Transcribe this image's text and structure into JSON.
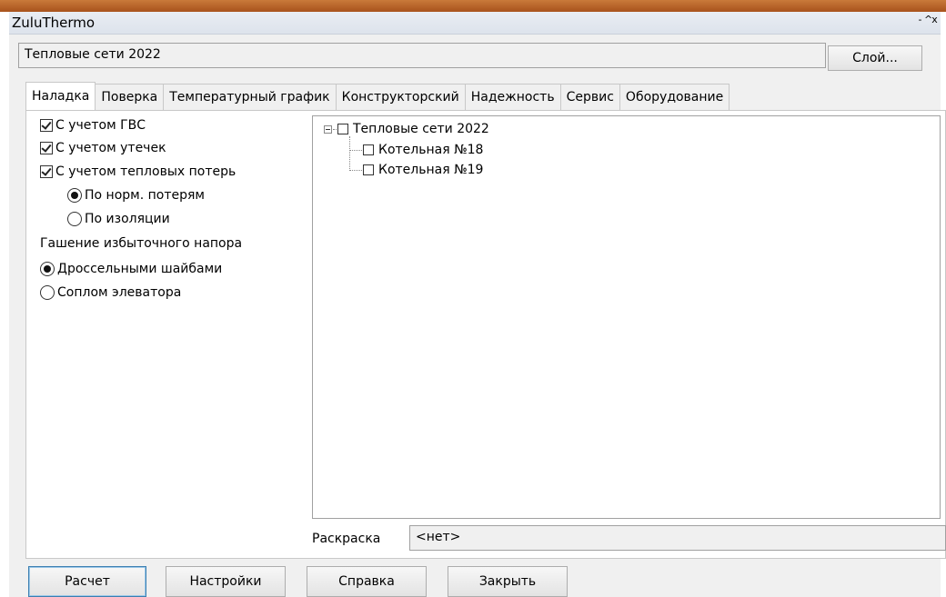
{
  "window": {
    "title": "ZuluThermo",
    "controls": [
      "-",
      "^",
      "x"
    ]
  },
  "layer": {
    "value": "Тепловые сети 2022",
    "button_label": "Слой..."
  },
  "tabs": [
    "Наладка",
    "Поверка",
    "Температурный график",
    "Конструкторский",
    "Надежность",
    "Сервис",
    "Оборудование"
  ],
  "active_tab": "Наладка",
  "options": {
    "gvs": "С учетом ГВС",
    "leaks": "С учетом утечек",
    "heat_loss": "С учетом тепловых потерь",
    "norm_loss": "По норм. потерям",
    "insulation": "По изоляции",
    "pressure_group": "Гашение избыточного напора",
    "throttle": "Дроссельными шайбами",
    "nozzle": "Соплом элеватора"
  },
  "tree": {
    "root": "Тепловые сети 2022",
    "children": [
      "Котельная №18",
      "Котельная №19"
    ]
  },
  "coloring": {
    "label": "Раскраска",
    "value": "<нет>"
  },
  "buttons": {
    "calc": "Расчет",
    "settings": "Настройки",
    "help": "Справка",
    "close": "Закрыть"
  },
  "colors": {
    "accent": "#3c7fb1",
    "top_strip": "#b35f25"
  }
}
